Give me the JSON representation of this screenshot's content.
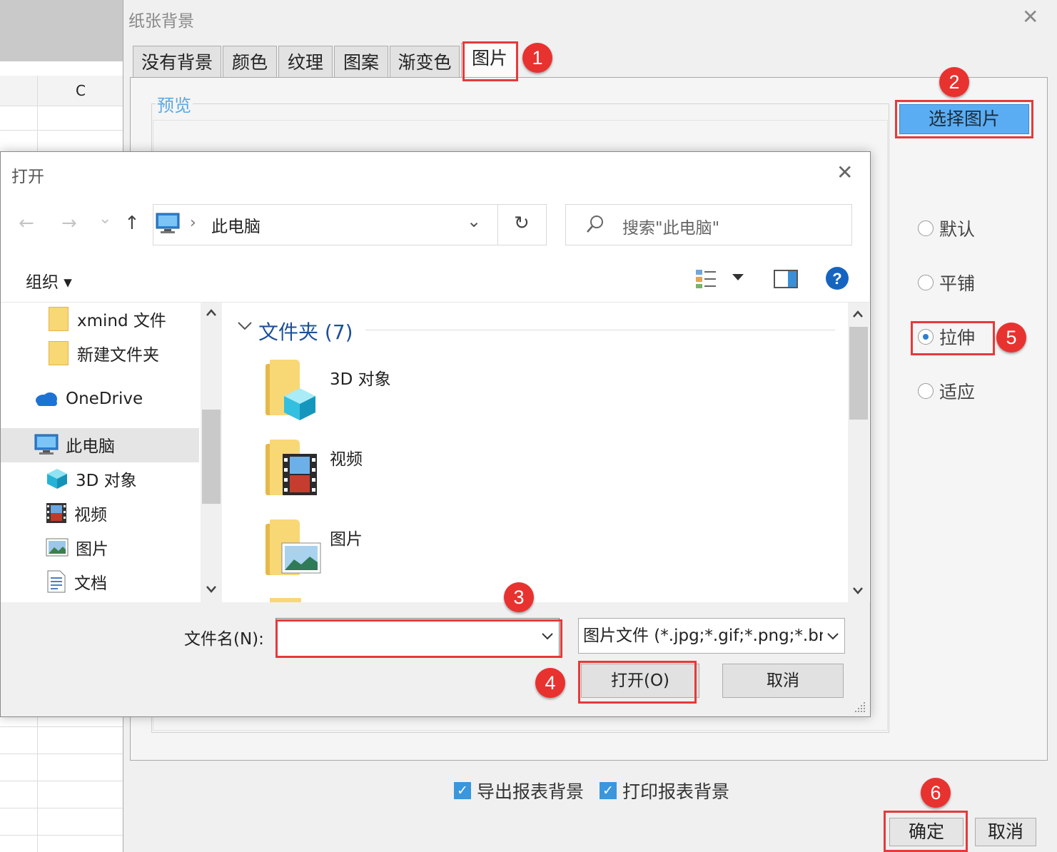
{
  "spreadsheet": {
    "column_c": "C"
  },
  "bg_dialog": {
    "title": "纸张背景",
    "close_glyph": "✕",
    "tabs": [
      {
        "label": "没有背景"
      },
      {
        "label": "颜色"
      },
      {
        "label": "纹理"
      },
      {
        "label": "图案"
      },
      {
        "label": "渐变色"
      },
      {
        "label": "图片",
        "active": true
      }
    ],
    "preview_label": "预览",
    "choose_button": "选择图片",
    "options": [
      {
        "label": "默认",
        "checked": false
      },
      {
        "label": "平铺",
        "checked": false
      },
      {
        "label": "拉伸",
        "checked": true
      },
      {
        "label": "适应",
        "checked": false
      }
    ],
    "checkboxes": [
      {
        "label": "导出报表背景",
        "checked": true
      },
      {
        "label": "打印报表背景",
        "checked": true
      }
    ],
    "ok_button": "确定",
    "cancel_button": "取消"
  },
  "open_dialog": {
    "title": "打开",
    "close_glyph": "✕",
    "nav": {
      "back": "←",
      "forward": "→",
      "recent": "⌄",
      "up": "↑"
    },
    "address": {
      "separator": "›",
      "location": "此电脑",
      "dropdown": "⌄",
      "refresh": "↻"
    },
    "search_placeholder": "搜索\"此电脑\"",
    "organize": "组织 ▾",
    "left_pane": [
      {
        "label": "xmind 文件",
        "icon": "folder-icon"
      },
      {
        "label": "新建文件夹",
        "icon": "folder-icon"
      },
      {
        "label": "OneDrive",
        "icon": "cloud-icon"
      },
      {
        "label": "此电脑",
        "icon": "computer-icon",
        "selected": true
      },
      {
        "label": "3D 对象",
        "icon": "cube-icon"
      },
      {
        "label": "视频",
        "icon": "film-icon"
      },
      {
        "label": "图片",
        "icon": "picture-icon"
      },
      {
        "label": "文档",
        "icon": "document-icon"
      }
    ],
    "group_header": "文件夹 (7)",
    "folders": [
      {
        "name": "3D 对象",
        "overlay": "cube-icon"
      },
      {
        "name": "视频",
        "overlay": "film-icon"
      },
      {
        "name": "图片",
        "overlay": "picture-icon"
      }
    ],
    "filename_label": "文件名(N):",
    "filename_value": "",
    "filetype": "图片文件 (*.jpg;*.gif;*.png;*.bmp)",
    "open_button": "打开(O)",
    "cancel_button": "取消"
  },
  "steps": [
    "1",
    "2",
    "3",
    "4",
    "5",
    "6"
  ],
  "colors": {
    "accent": "#3a96dd",
    "annotation": "#e63a3a",
    "preview": "#58a9e6"
  }
}
